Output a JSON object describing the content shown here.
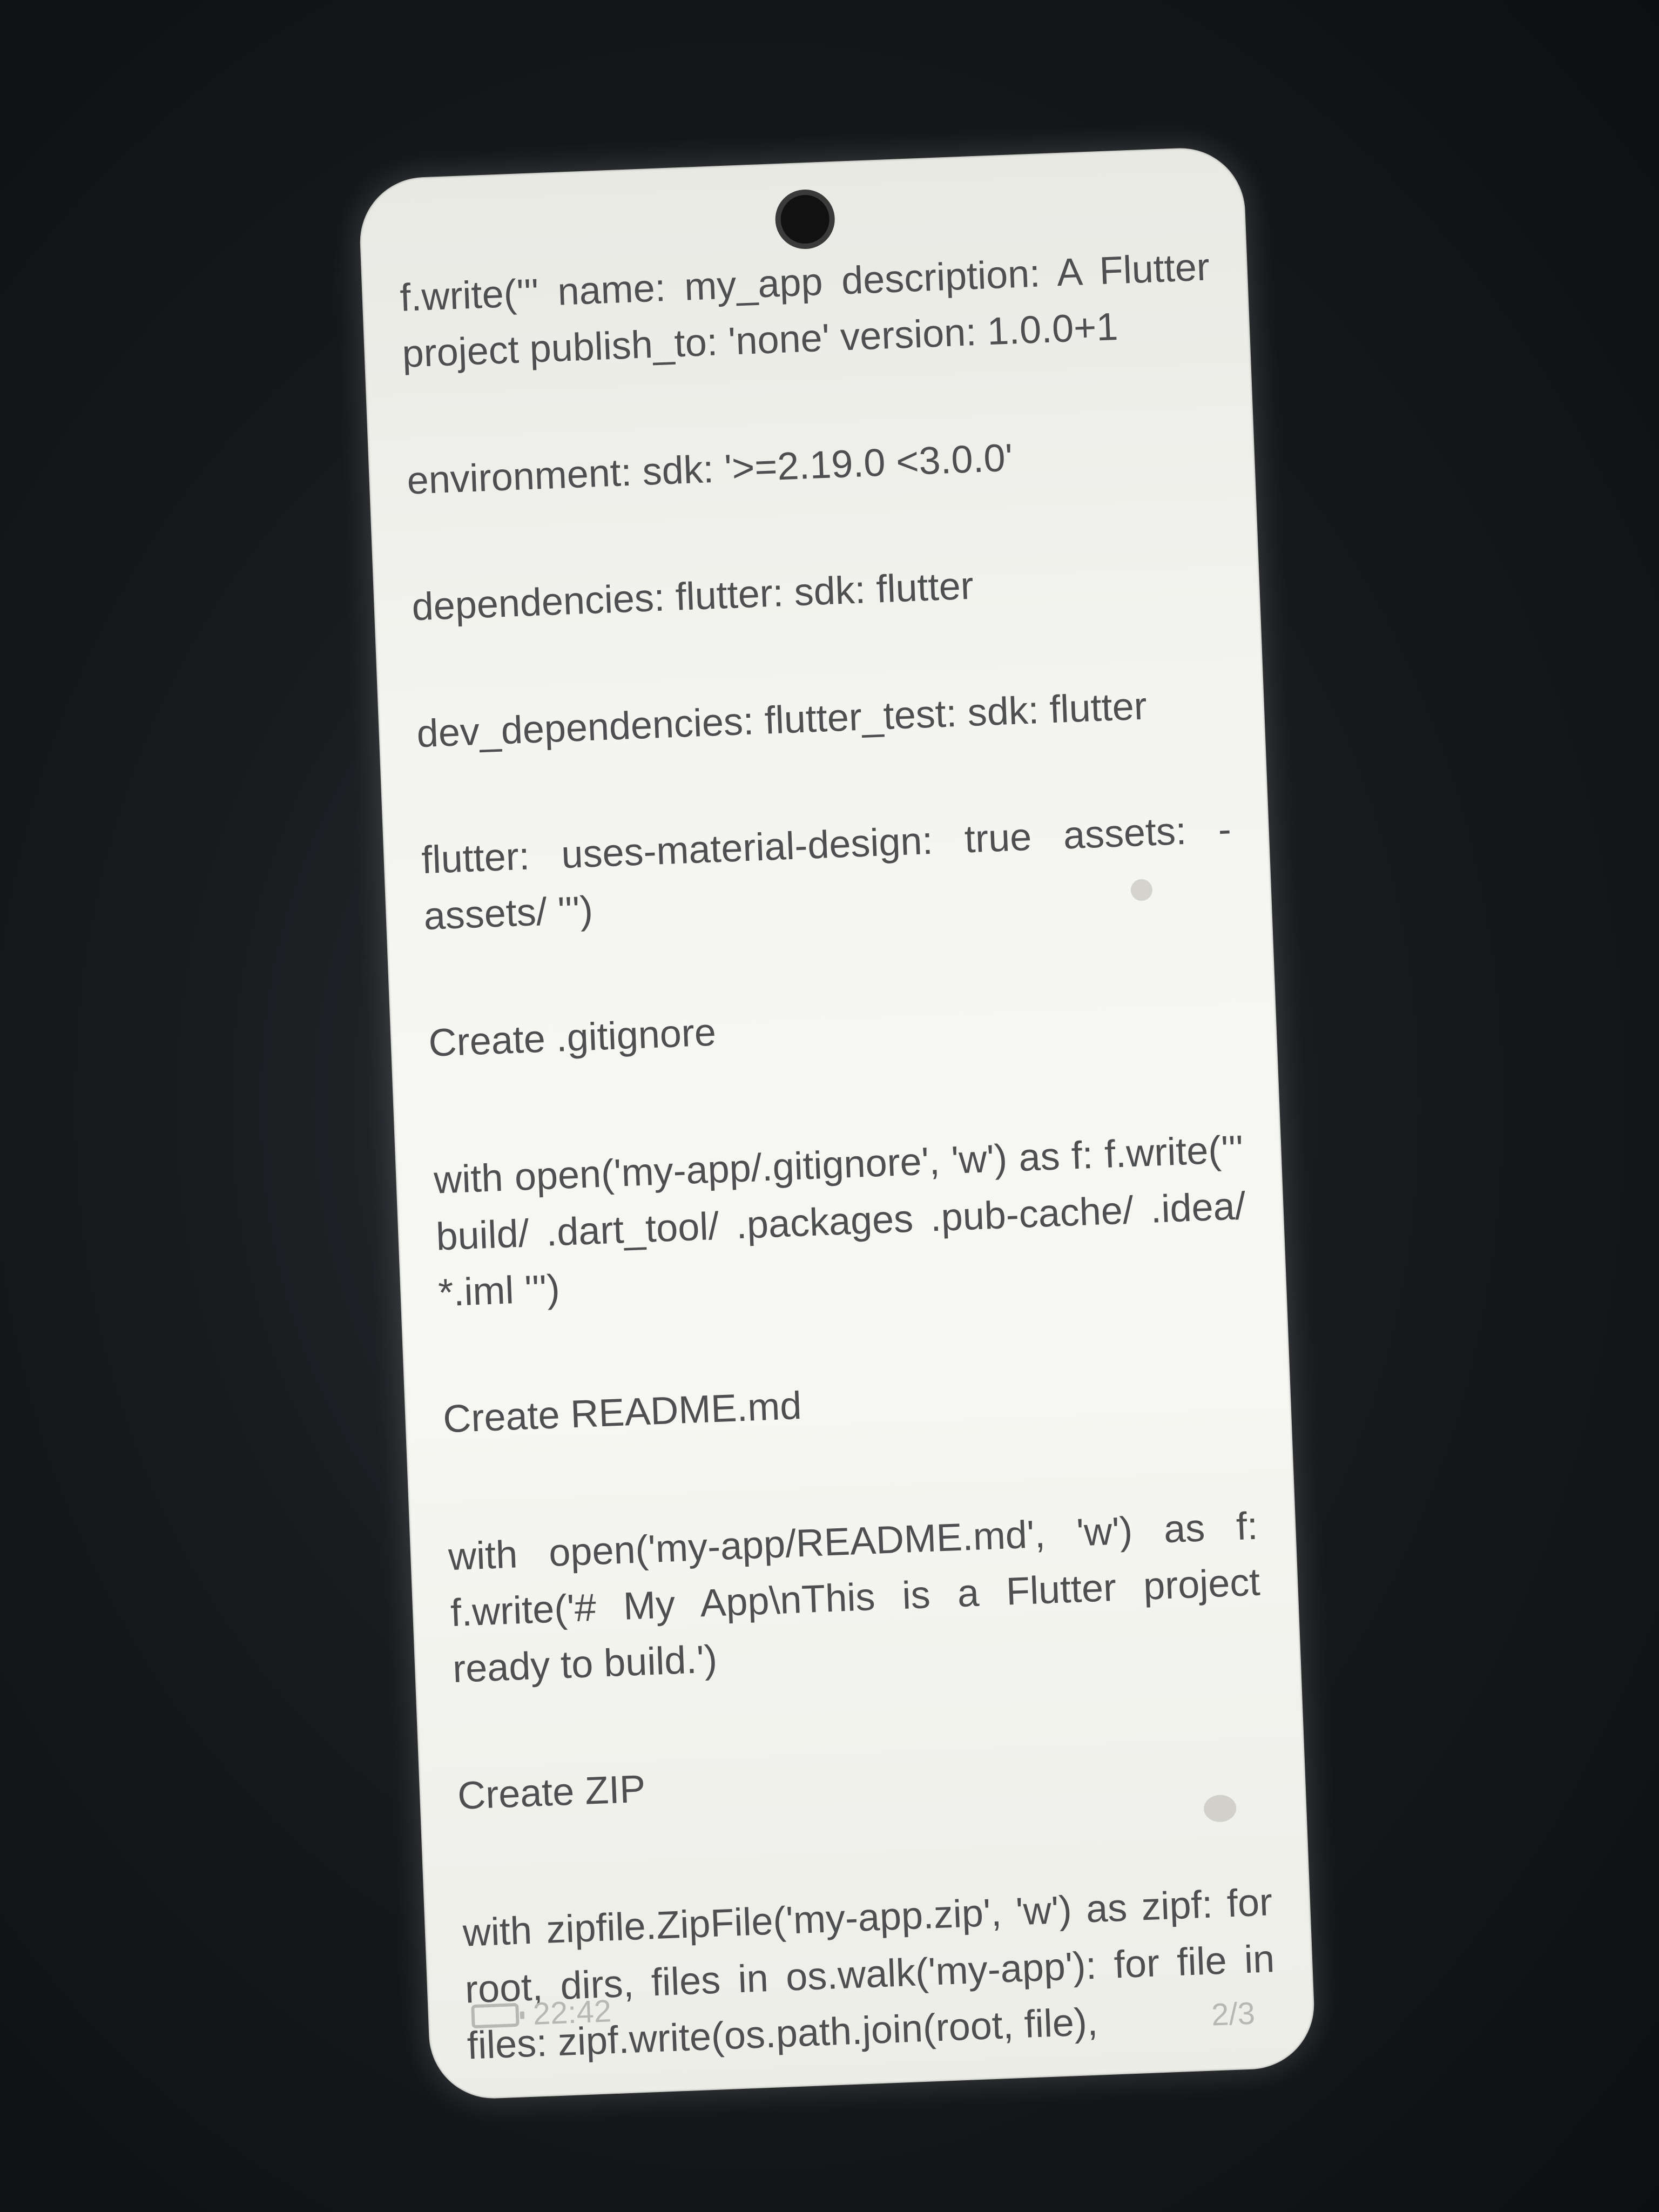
{
  "document": {
    "paragraphs": [
      "f.write(''' name: my_app description: A Flutter project publish_to: 'none' version: 1.0.0+1",
      "environment: sdk: '>=2.19.0 <3.0.0'",
      "dependencies: flutter: sdk: flutter",
      "dev_dependencies: flutter_test: sdk: flutter",
      "flutter: uses-material-design: true assets: - assets/ ''')",
      "Create .gitignore",
      "with open('my-app/.gitignore', 'w') as f: f.write(''' build/ .dart_tool/ .packages .pub-cache/ .idea/ *.iml ''')",
      "Create README.md",
      "with open('my-app/README.md', 'w') as f: f.write('# My App\\nThis is a Flutter project ready to build.')",
      "Create ZIP",
      "with zipfile.ZipFile('my-app.zip', 'w') as zipf: for root, dirs, files in os.walk('my-app'): for file in files: zipf.write(os.path.join(root, file),"
    ]
  },
  "status_bar": {
    "time": "22:42",
    "battery_icon": "battery-icon"
  },
  "page_indicator": "2/3",
  "colors": {
    "text": "#4e4f51",
    "screen_background": "#f4f4f0",
    "status_text": "#b7b8b6",
    "surround": "#121417"
  }
}
